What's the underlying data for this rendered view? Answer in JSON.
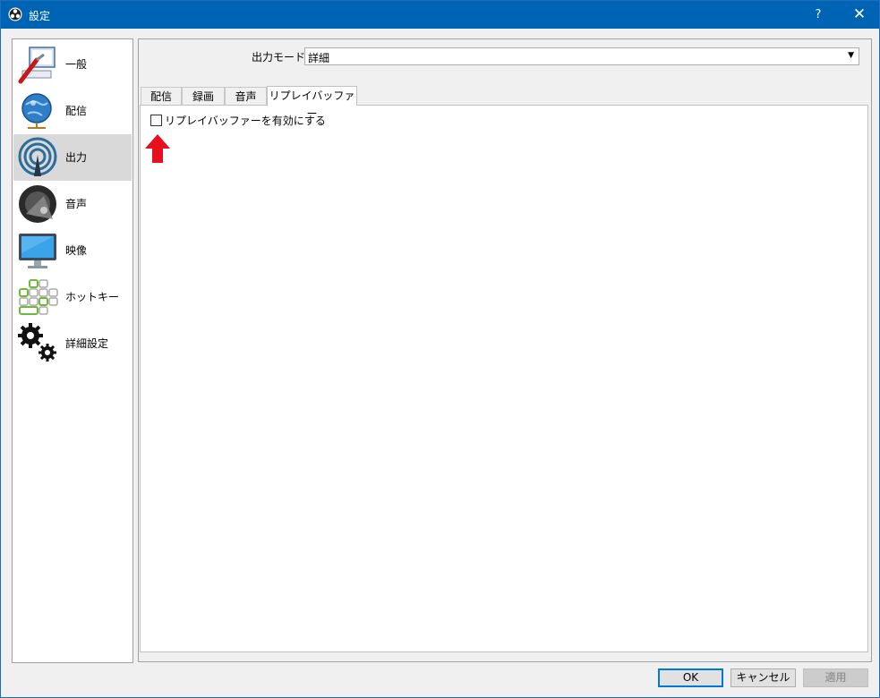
{
  "window": {
    "title": "設定",
    "help_glyph": "?",
    "close_glyph": "✕"
  },
  "sidebar": {
    "items": [
      {
        "label": "一般",
        "icon": "general-icon",
        "selected": false
      },
      {
        "label": "配信",
        "icon": "globe-icon",
        "selected": false
      },
      {
        "label": "出力",
        "icon": "broadcast-icon",
        "selected": true
      },
      {
        "label": "音声",
        "icon": "speaker-icon",
        "selected": false
      },
      {
        "label": "映像",
        "icon": "monitor-icon",
        "selected": false
      },
      {
        "label": "ホットキー",
        "icon": "keyboard-icon",
        "selected": false
      },
      {
        "label": "詳細設定",
        "icon": "gears-icon",
        "selected": false
      }
    ]
  },
  "output": {
    "mode_label": "出力モード",
    "mode_value": "詳細",
    "tabs": [
      {
        "label": "配信"
      },
      {
        "label": "録画"
      },
      {
        "label": "音声"
      },
      {
        "label": "リプレイバッファー",
        "active": true
      }
    ],
    "replay": {
      "enable_label": "リプレイバッファーを有効にする",
      "enabled": false
    }
  },
  "buttons": {
    "ok": "OK",
    "cancel": "キャンセル",
    "apply": "適用"
  },
  "colors": {
    "titlebar": "#0064b4",
    "selection": "#d9d9d9",
    "arrow": "#e8101c"
  }
}
